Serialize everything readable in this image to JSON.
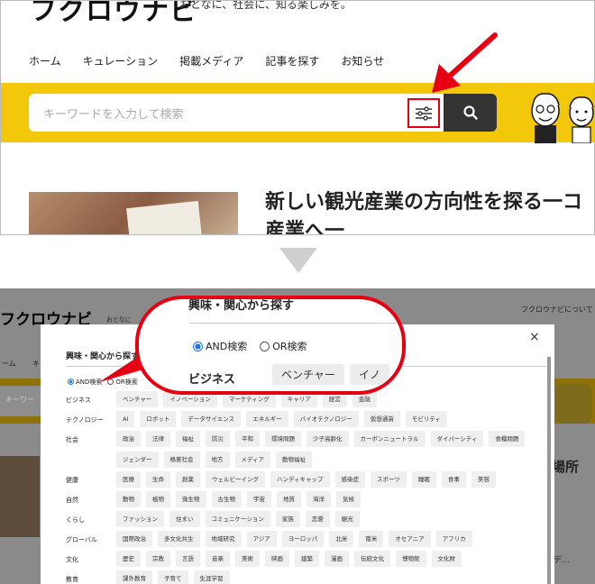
{
  "top": {
    "logo": "フクロウナビ",
    "tagline": "おとなに、社会に、知る楽しみを。",
    "nav": [
      "ホーム",
      "キュレーション",
      "掲載メディア",
      "記事を探す",
      "お知らせ"
    ],
    "search_placeholder": "キーワードを入力して検索",
    "article_title": "新しい観光産業の方向性を探る一コ",
    "article_title_line2": "産業へ一"
  },
  "bottom": {
    "logo": "フクロウナビ",
    "tagline": "おとなに",
    "about": "フクロウナビについて",
    "home_cut": "ーム",
    "nav_cut": "キ",
    "search_cut": "キーワー",
    "article_cut": "場所",
    "dots": "デ…",
    "modal": {
      "close": "×",
      "title": "興味・関心から探す",
      "and_label": "AND検索",
      "or_label": "OR検索",
      "rows": [
        {
          "label": "ビジネス",
          "tags": [
            "ベンチャー",
            "イノベーション",
            "マーケティング",
            "キャリア",
            "経営",
            "金融"
          ]
        },
        {
          "label": "テクノロジー",
          "tags": [
            "AI",
            "ロボット",
            "データサイエンス",
            "エネルギー",
            "バイオテクノロジー",
            "仮想通貨",
            "モビリティ"
          ]
        },
        {
          "label": "社会",
          "tags": [
            "政治",
            "法律",
            "福祉",
            "防災",
            "平和",
            "環境問題",
            "少子高齢化",
            "カーボンニュートラル",
            "ダイバーシティ",
            "食糧問題",
            "ジェンダー",
            "格差社会",
            "地方",
            "メディア",
            "動物福祉"
          ]
        },
        {
          "label": "健康",
          "tags": [
            "医療",
            "生命",
            "創薬",
            "ウェルビーイング",
            "ハンディキャップ",
            "感染症",
            "スポーツ",
            "睡眠",
            "食事",
            "美容"
          ]
        },
        {
          "label": "自然",
          "tags": [
            "動物",
            "植物",
            "微生物",
            "古生物",
            "宇宙",
            "地質",
            "海洋",
            "気候"
          ]
        },
        {
          "label": "くらし",
          "tags": [
            "ファッション",
            "住まい",
            "コミュニケーション",
            "家族",
            "恋愛",
            "観光"
          ]
        },
        {
          "label": "グローバル",
          "tags": [
            "国際政治",
            "多文化共生",
            "地域研究",
            "アジア",
            "ヨーロッパ",
            "北米",
            "南米",
            "オセアニア",
            "アフリカ"
          ]
        },
        {
          "label": "文化",
          "tags": [
            "歴史",
            "宗教",
            "言語",
            "音楽",
            "美術",
            "映画",
            "建築",
            "漫画",
            "伝統文化",
            "博物館",
            "文化財"
          ]
        },
        {
          "label": "教育",
          "tags": [
            "課外教育",
            "子育て",
            "生涯学習"
          ]
        }
      ]
    },
    "zoom": {
      "title": "興味・関心から探す",
      "and_label": "AND検索",
      "or_label": "OR検索",
      "biz": "ビジネス",
      "tag1": "ベンチャー",
      "tag2": "イノ"
    }
  },
  "colors": {
    "accent": "#e60012",
    "yellow": "#f3c80a",
    "dark": "#333333"
  }
}
